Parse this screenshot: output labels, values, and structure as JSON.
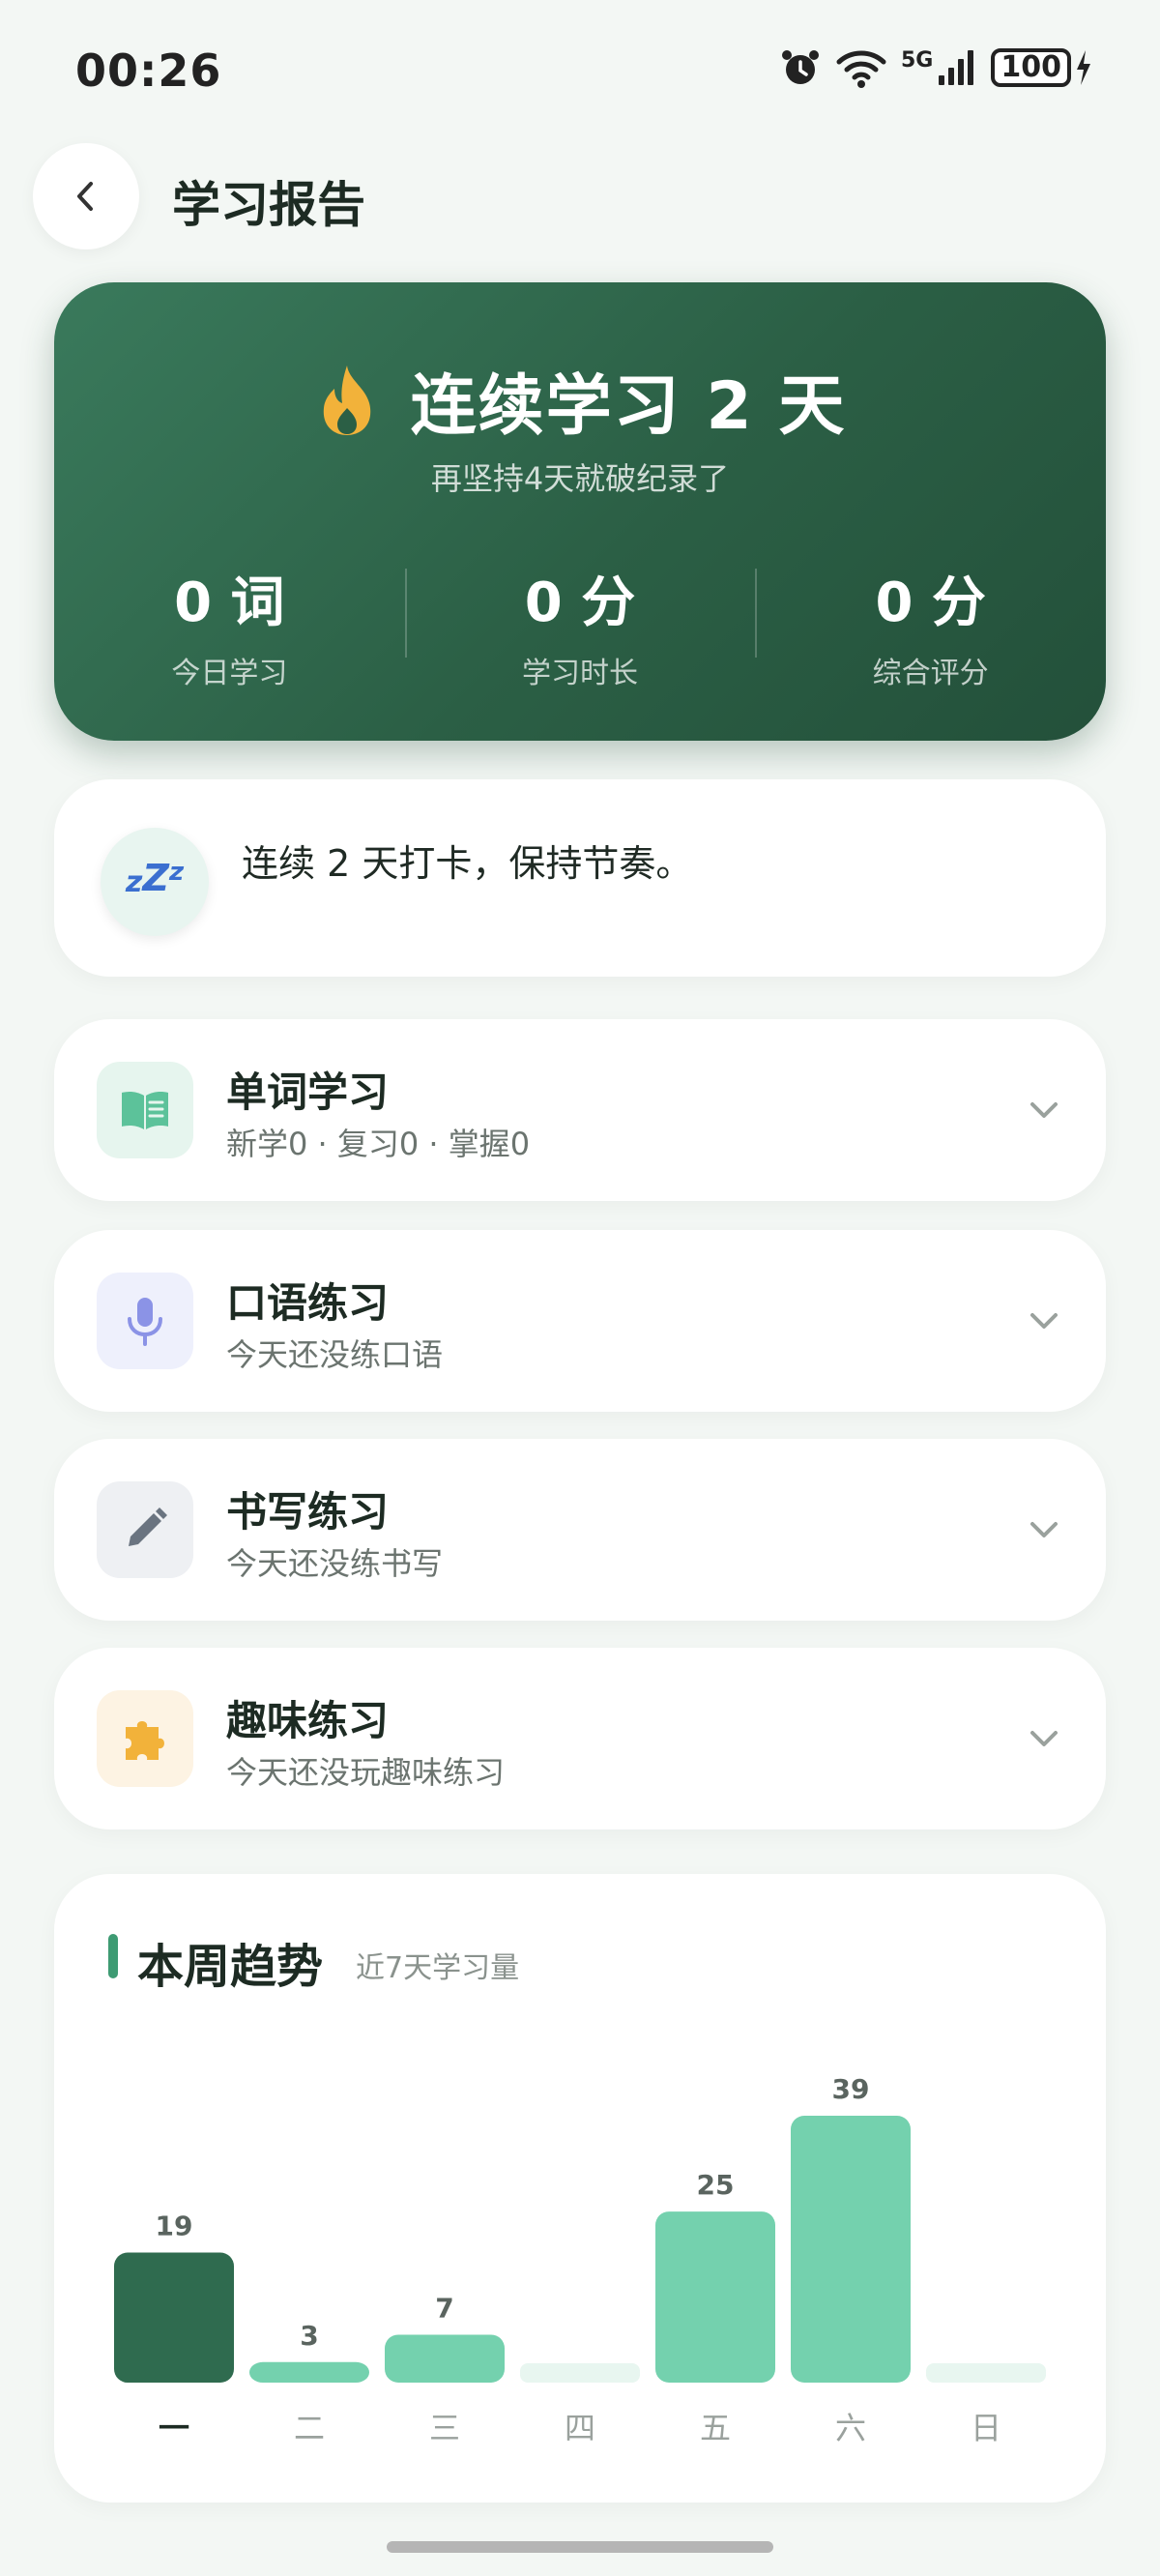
{
  "status_bar": {
    "time": "00:26",
    "network": "5G",
    "battery": "100"
  },
  "header": {
    "title": "学习报告",
    "back_icon": "chevron-left-icon"
  },
  "hero": {
    "title": "连续学习 2 天",
    "subtitle": "再坚持4天就破纪录了",
    "icon": "flame-icon",
    "stats": [
      {
        "value": "0 词",
        "label": "今日学习"
      },
      {
        "value": "0 分",
        "label": "学习时长"
      },
      {
        "value": "0 分",
        "label": "综合评分"
      }
    ],
    "colors": {
      "gradient_start": "#3a7a5c",
      "gradient_end": "#23503a",
      "flame": "#f2b23a"
    }
  },
  "streak": {
    "icon": "sleep-zzz-icon",
    "text": "连续 2 天打卡，保持节奏。"
  },
  "modules": [
    {
      "title": "单词学习",
      "subtitle": "新学0 · 复习0 · 掌握0",
      "icon": "book-icon",
      "icon_color": "#5cc29a",
      "icon_bg": "#e6f5ee"
    },
    {
      "title": "口语练习",
      "subtitle": "今天还没练口语",
      "icon": "microphone-icon",
      "icon_color": "#8b93e6",
      "icon_bg": "#eef0fc"
    },
    {
      "title": "书写练习",
      "subtitle": "今天还没练书写",
      "icon": "pencil-icon",
      "icon_color": "#6a7480",
      "icon_bg": "#eef0f3"
    },
    {
      "title": "趣味练习",
      "subtitle": "今天还没玩趣味练习",
      "icon": "puzzle-icon",
      "icon_color": "#f2b23a",
      "icon_bg": "#fdf3e3"
    }
  ],
  "trend": {
    "title": "本周趋势",
    "subtitle": "近7天学习量"
  },
  "chart_data": {
    "type": "bar",
    "categories": [
      "一",
      "二",
      "三",
      "四",
      "五",
      "六",
      "日"
    ],
    "values": [
      19,
      3,
      7,
      0,
      25,
      39,
      0
    ],
    "highlight_index": 0,
    "colors": {
      "today": "#2f6b4f",
      "bar": "#74d1ae",
      "empty": "#e8f6f0",
      "label": "#5a645f"
    },
    "grid": false
  }
}
